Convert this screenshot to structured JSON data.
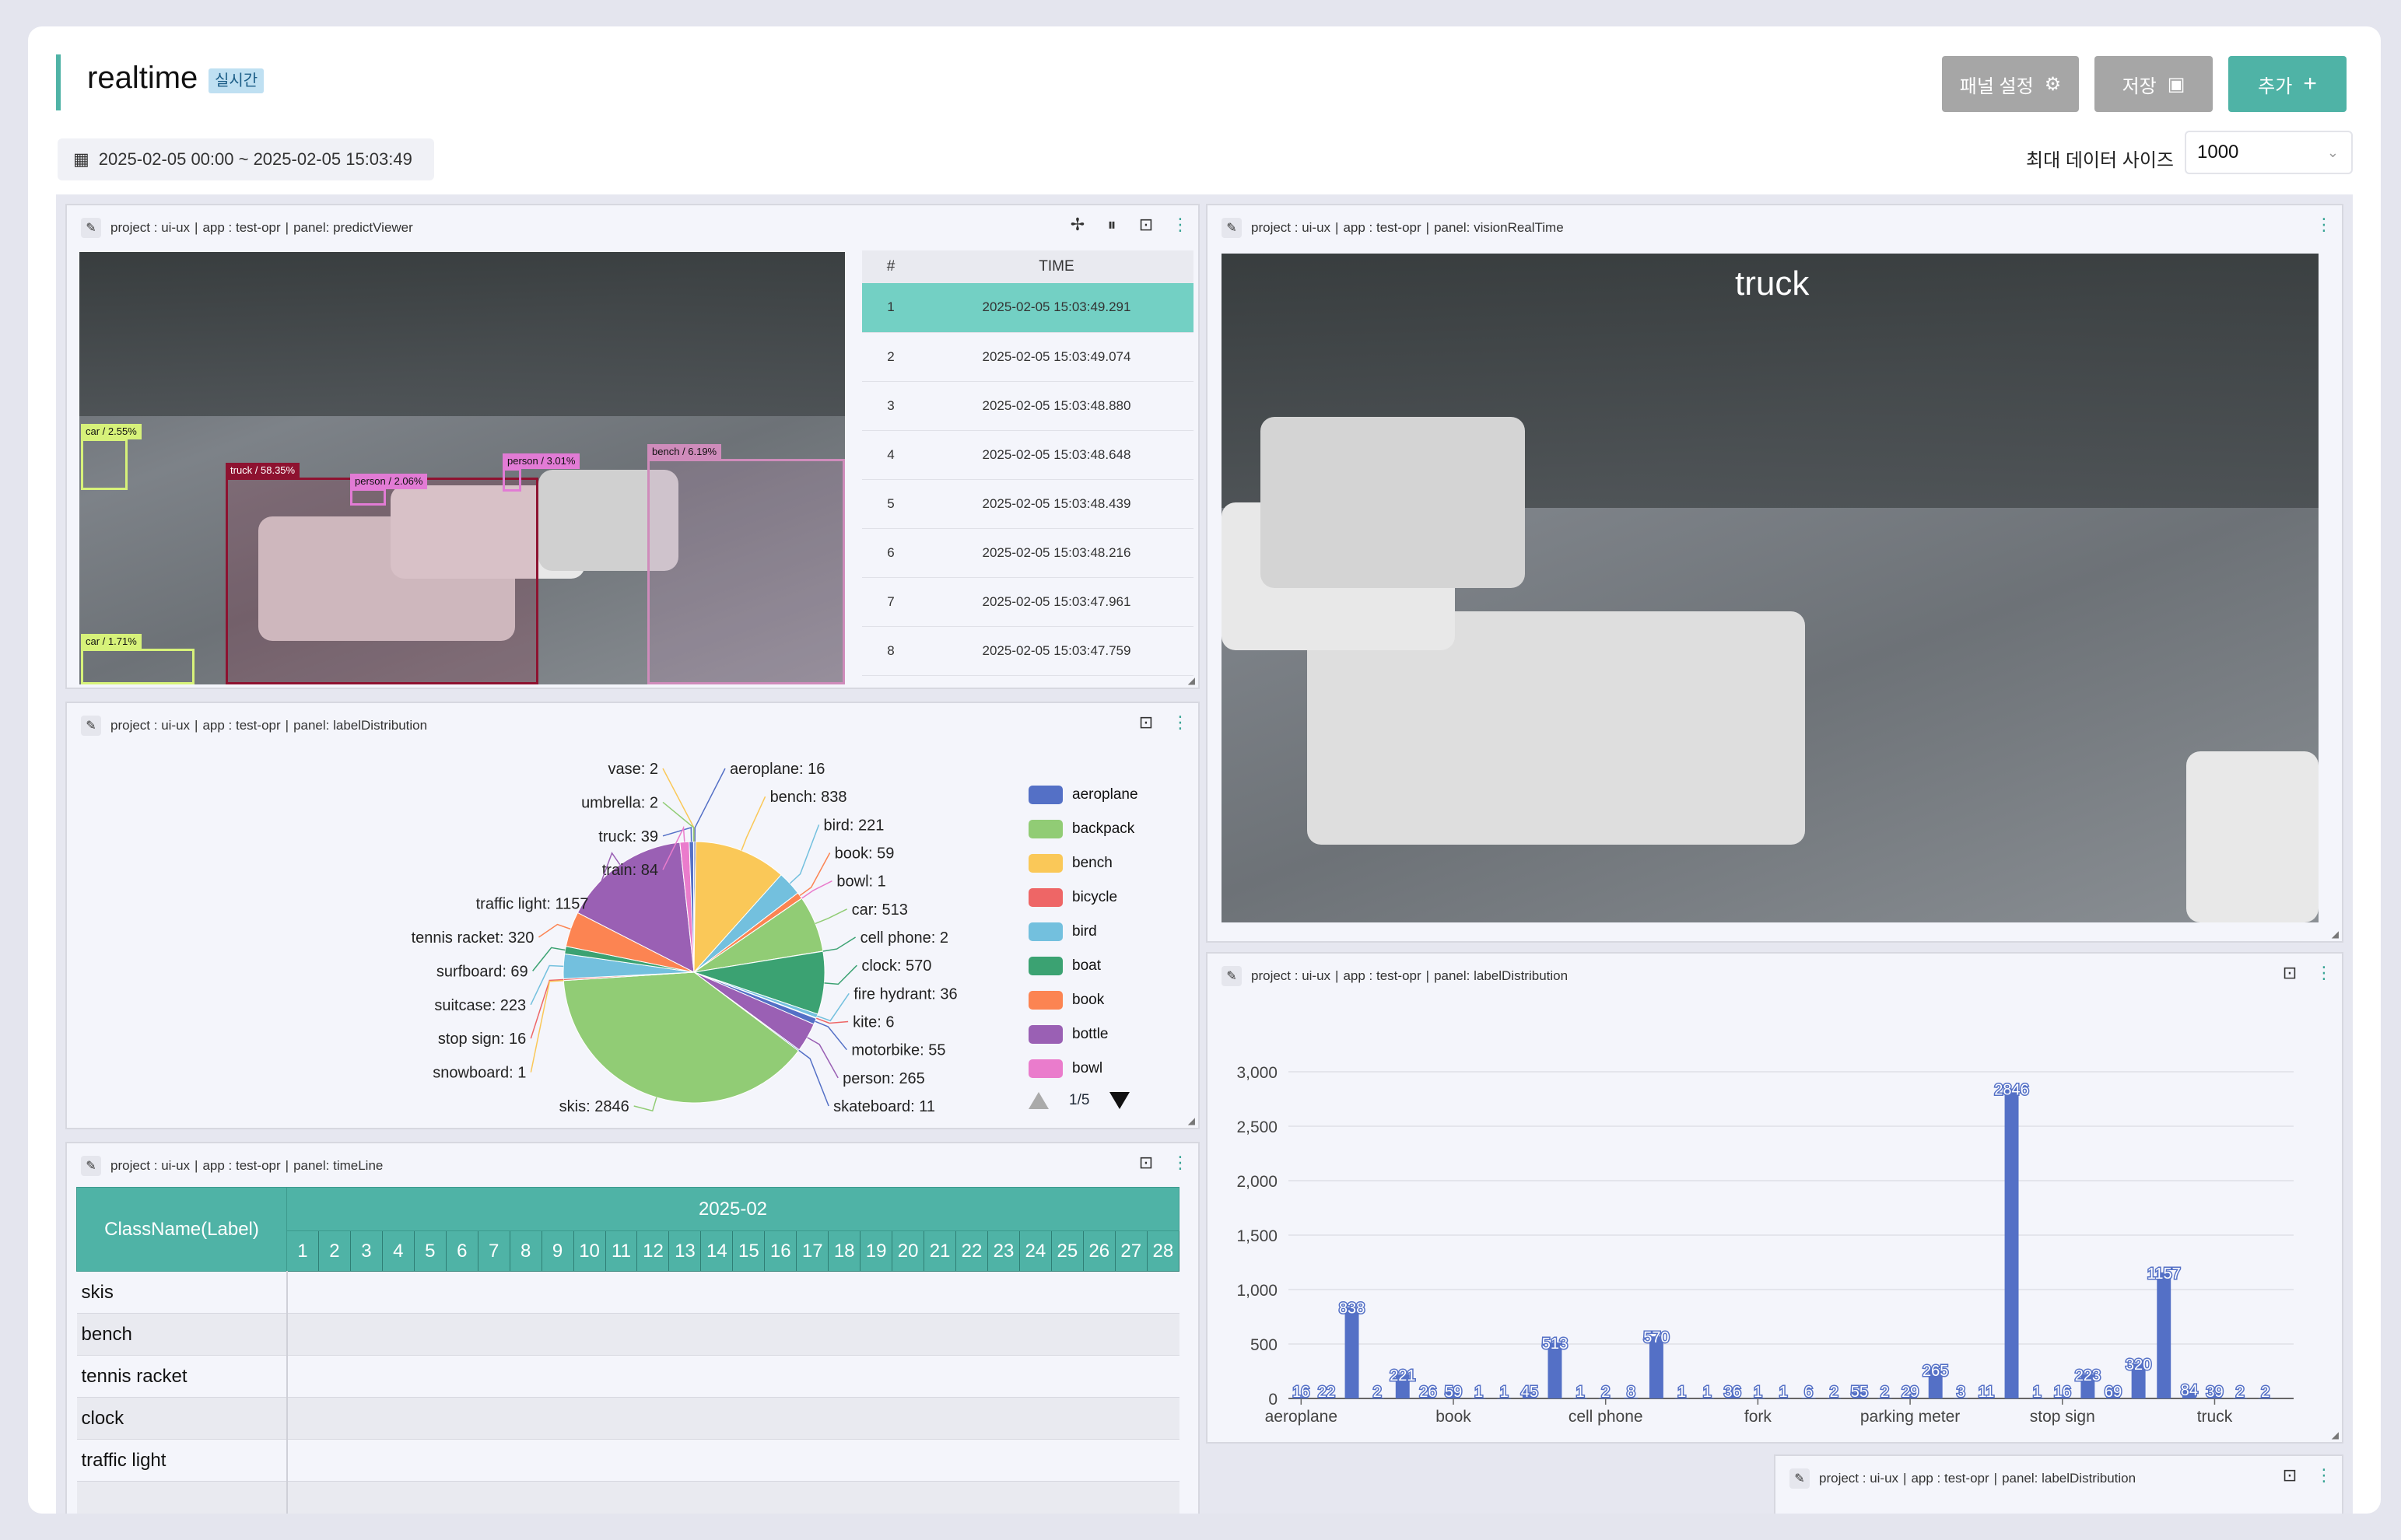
{
  "page": {
    "title": "realtime",
    "badge": "실시간"
  },
  "header": {
    "panel_settings": "패널 설정",
    "save": "저장",
    "add": "추가",
    "date_range": "2025-02-05 00:00 ~ 2025-02-05 15:03:49",
    "max_label": "최대 데이터 사이즈",
    "max_value": "1000"
  },
  "panel_bar": {
    "project": "project : ui-ux",
    "app": "app : test-opr",
    "sep": "|"
  },
  "panels": {
    "predict": "panel: predictViewer",
    "vision": "panel: visionRealTime",
    "pie": "panel: labelDistribution",
    "bar": "panel: labelDistribution",
    "timeline": "panel: timeLine",
    "extra": "panel: labelDistribution"
  },
  "predict": {
    "detections": [
      {
        "label": "car / 2.55%",
        "color": "#d7f27a"
      },
      {
        "label": "truck / 58.35%",
        "color": "#8e1230"
      },
      {
        "label": "person / 2.06%",
        "color": "#e27bd5"
      },
      {
        "label": "person / 3.01%",
        "color": "#e27bd5"
      },
      {
        "label": "bench / 6.19%",
        "color": "#cf8cbb"
      },
      {
        "label": "car / 1.71%",
        "color": "#d7f27a"
      }
    ],
    "table": {
      "col_num": "#",
      "col_time": "TIME",
      "rows": [
        {
          "n": "1",
          "t": "2025-02-05 15:03:49.291"
        },
        {
          "n": "2",
          "t": "2025-02-05 15:03:49.074"
        },
        {
          "n": "3",
          "t": "2025-02-05 15:03:48.880"
        },
        {
          "n": "4",
          "t": "2025-02-05 15:03:48.648"
        },
        {
          "n": "5",
          "t": "2025-02-05 15:03:48.439"
        },
        {
          "n": "6",
          "t": "2025-02-05 15:03:48.216"
        },
        {
          "n": "7",
          "t": "2025-02-05 15:03:47.961"
        },
        {
          "n": "8",
          "t": "2025-02-05 15:03:47.759"
        }
      ]
    }
  },
  "vision": {
    "label": "truck"
  },
  "legend": {
    "items": [
      {
        "name": "aeroplane",
        "color": "#5470c6"
      },
      {
        "name": "backpack",
        "color": "#91cc75"
      },
      {
        "name": "bench",
        "color": "#fac858"
      },
      {
        "name": "bicycle",
        "color": "#ee6666"
      },
      {
        "name": "bird",
        "color": "#73c0de"
      },
      {
        "name": "boat",
        "color": "#3ba272"
      },
      {
        "name": "book",
        "color": "#fc8452"
      },
      {
        "name": "bottle",
        "color": "#9a60b4"
      },
      {
        "name": "bowl",
        "color": "#ea7ccc"
      }
    ],
    "page": "1/5"
  },
  "timeline": {
    "header": "ClassName(Label)",
    "month": "2025-02",
    "days": [
      "1",
      "2",
      "3",
      "4",
      "5",
      "6",
      "7",
      "8",
      "9",
      "10",
      "11",
      "12",
      "13",
      "14",
      "15",
      "16",
      "17",
      "18",
      "19",
      "20",
      "21",
      "22",
      "23",
      "24",
      "25",
      "26",
      "27",
      "28"
    ],
    "rows": [
      "skis",
      "bench",
      "tennis racket",
      "clock",
      "traffic light",
      ""
    ]
  },
  "chart_data": [
    {
      "type": "pie",
      "title": "",
      "slices": [
        {
          "label": "aeroplane",
          "value": 16,
          "color": "#5470c6"
        },
        {
          "label": "bench",
          "value": 838,
          "color": "#fac858"
        },
        {
          "label": "bird",
          "value": 221,
          "color": "#73c0de"
        },
        {
          "label": "book",
          "value": 59,
          "color": "#fc8452"
        },
        {
          "label": "bowl",
          "value": 1,
          "color": "#ea7ccc"
        },
        {
          "label": "car",
          "value": 513,
          "color": "#91cc75"
        },
        {
          "label": "cell phone",
          "value": 2,
          "color": "#3ba272"
        },
        {
          "label": "clock",
          "value": 570,
          "color": "#3ba272"
        },
        {
          "label": "fire hydrant",
          "value": 36,
          "color": "#73c0de"
        },
        {
          "label": "kite",
          "value": 6,
          "color": "#ee6666"
        },
        {
          "label": "motorbike",
          "value": 55,
          "color": "#5470c6"
        },
        {
          "label": "person",
          "value": 265,
          "color": "#9a60b4"
        },
        {
          "label": "skateboard",
          "value": 11,
          "color": "#5470c6"
        },
        {
          "label": "skis",
          "value": 2846,
          "color": "#91cc75"
        },
        {
          "label": "snowboard",
          "value": 1,
          "color": "#fac858"
        },
        {
          "label": "stop sign",
          "value": 16,
          "color": "#ee6666"
        },
        {
          "label": "suitcase",
          "value": 223,
          "color": "#73c0de"
        },
        {
          "label": "surfboard",
          "value": 69,
          "color": "#3ba272"
        },
        {
          "label": "tennis racket",
          "value": 320,
          "color": "#fc8452"
        },
        {
          "label": "traffic light",
          "value": 1157,
          "color": "#9a60b4"
        },
        {
          "label": "train",
          "value": 84,
          "color": "#ea7ccc"
        },
        {
          "label": "truck",
          "value": 39,
          "color": "#5470c6"
        },
        {
          "label": "umbrella",
          "value": 2,
          "color": "#91cc75"
        },
        {
          "label": "vase",
          "value": 2,
          "color": "#fac858"
        }
      ]
    },
    {
      "type": "bar",
      "title": "",
      "xlabel": "",
      "ylabel": "",
      "ylim": [
        0,
        3000
      ],
      "yticks": [
        "0",
        "500",
        "1,000",
        "1,500",
        "2,000",
        "2,500",
        "3,000"
      ],
      "xtick_labels": [
        "aeroplane",
        "book",
        "cell phone",
        "fork",
        "parking meter",
        "stop sign",
        "truck"
      ],
      "values": [
        16,
        22,
        838,
        2,
        221,
        26,
        59,
        1,
        1,
        45,
        513,
        1,
        2,
        8,
        570,
        1,
        1,
        36,
        1,
        1,
        6,
        2,
        55,
        2,
        29,
        265,
        3,
        11,
        2846,
        1,
        16,
        223,
        69,
        320,
        1157,
        84,
        39,
        2,
        2
      ],
      "bar_labels": [
        "16",
        "22",
        "838",
        "2",
        "221",
        "26",
        "59",
        "1",
        "1",
        "45",
        "513",
        "1",
        "2",
        "8",
        "570",
        "1",
        "1",
        "36",
        "1",
        "1",
        "6",
        "2",
        "55",
        "2",
        "29",
        "265",
        "3",
        "11",
        "2846",
        "1",
        "16",
        "223",
        "69",
        "320",
        "1157",
        "84",
        "39",
        "2",
        "2"
      ],
      "color": "#5470c6"
    }
  ]
}
